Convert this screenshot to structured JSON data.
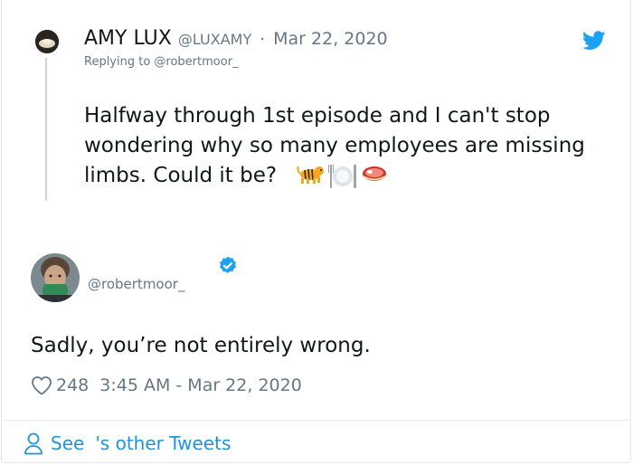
{
  "colors": {
    "twitter_blue": "#1da1f2",
    "link_blue": "#1b95e0",
    "muted_gray": "#657786",
    "text_dark": "#14171a",
    "border": "#e1e8ed"
  },
  "reply_tweet": {
    "display_name": "AMY LUX",
    "handle": "@LUXAMY",
    "separator": "·",
    "date": "Mar 22, 2020",
    "replying_to": "Replying to @robertmoor_",
    "text": "Halfway through 1st episode and I can't stop wondering why so many employees are missing limbs. Could it be?",
    "emojis": [
      "tiger-emoji",
      "fork-knife-plate-emoji",
      "meat-emoji"
    ],
    "icon": "twitter-bird-icon"
  },
  "main_tweet": {
    "handle": "@robertmoor_",
    "verified_icon": "verified-badge-icon",
    "text": "Sadly, you’re not entirely wrong.",
    "like_icon": "heart-icon",
    "likes": "248",
    "timestamp": "3:45 AM - Mar 22, 2020"
  },
  "footer": {
    "icon": "person-icon",
    "see_label": "See",
    "other_tweets_label": "'s other Tweets"
  }
}
